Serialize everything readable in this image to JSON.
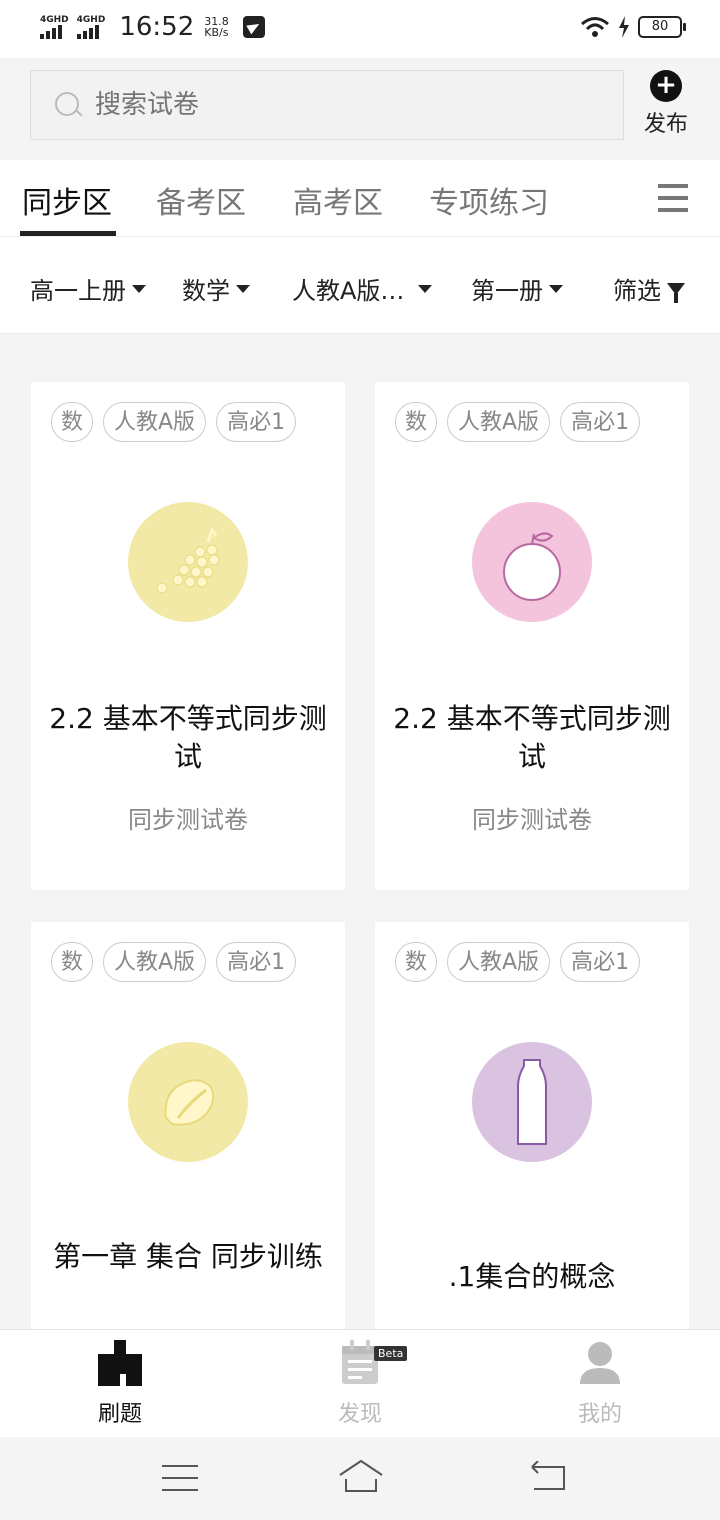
{
  "status_bar": {
    "signal1": "4GHD",
    "signal2": "4GHD",
    "time": "16:52",
    "speed_value": "31.8",
    "speed_unit": "KB/s",
    "battery": "80"
  },
  "search": {
    "placeholder": "搜索试卷"
  },
  "publish": {
    "label": "发布"
  },
  "tabs": [
    {
      "label": "同步区",
      "active": true
    },
    {
      "label": "备考区"
    },
    {
      "label": "高考区"
    },
    {
      "label": "专项练习"
    }
  ],
  "filters": [
    {
      "label": "高一上册"
    },
    {
      "label": "数学"
    },
    {
      "label": "人教A版…"
    },
    {
      "label": "第一册"
    },
    {
      "label": "筛选"
    }
  ],
  "cards": [
    {
      "tags": [
        "数",
        "人教A版",
        "高必1"
      ],
      "icon": "grapes-icon",
      "color": "#f3e9a6",
      "title": "2.2 基本不等式同步测试",
      "subtitle": "同步测试卷"
    },
    {
      "tags": [
        "数",
        "人教A版",
        "高必1"
      ],
      "icon": "apple-icon",
      "color": "#f3c4dc",
      "title": "2.2 基本不等式同步测试",
      "subtitle": "同步测试卷"
    },
    {
      "tags": [
        "数",
        "人教A版",
        "高必1"
      ],
      "icon": "leaf-icon",
      "color": "#f3e9a6",
      "title": "第一章 集合 同步训练",
      "subtitle": ""
    },
    {
      "tags": [
        "数",
        "人教A版",
        "高必1"
      ],
      "icon": "bottle-icon",
      "color": "#d9c3e1",
      "title": ".1集合的概念",
      "subtitle": ""
    }
  ],
  "bottom_nav": [
    {
      "label": "刷题",
      "active": true
    },
    {
      "label": "发现",
      "badge": "Beta"
    },
    {
      "label": "我的"
    }
  ]
}
